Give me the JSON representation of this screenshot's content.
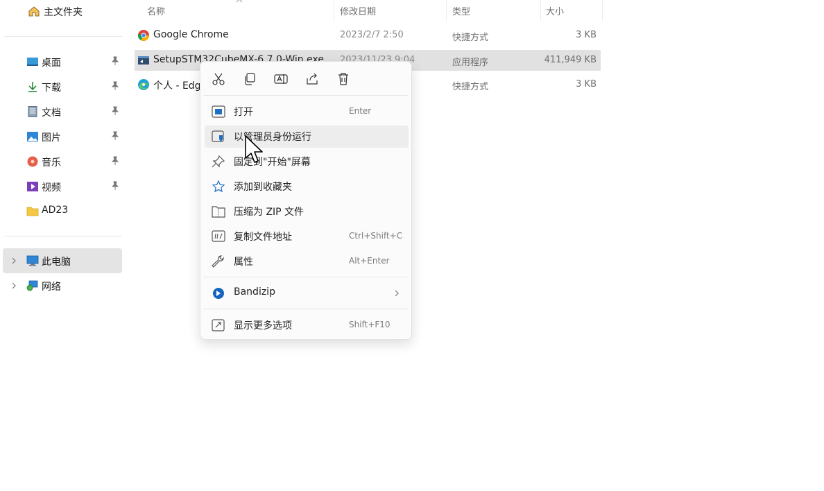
{
  "sidebar": {
    "home": "主文件夹",
    "quick_access": [
      {
        "label": "桌面",
        "icon": "desktop-icon"
      },
      {
        "label": "下载",
        "icon": "download-icon"
      },
      {
        "label": "文档",
        "icon": "document-icon"
      },
      {
        "label": "图片",
        "icon": "picture-icon"
      },
      {
        "label": "音乐",
        "icon": "music-icon"
      },
      {
        "label": "视频",
        "icon": "video-icon"
      },
      {
        "label": "AD23",
        "icon": "folder-icon"
      }
    ],
    "this_pc": "此电脑",
    "network": "网络"
  },
  "columns": {
    "name": "名称",
    "modified": "修改日期",
    "type": "类型",
    "size": "大小"
  },
  "files": [
    {
      "name": "Google Chrome",
      "modified": "2023/2/7 2:50",
      "type": "快捷方式",
      "size": "3 KB",
      "icon": "chrome-icon"
    },
    {
      "name": "SetupSTM32CubeMX-6.7.0-Win.exe",
      "modified": "2023/11/23 9:04",
      "type": "应用程序",
      "size": "411,949 KB",
      "icon": "stm32-installer-icon",
      "selected": true
    },
    {
      "name": "个人 - Edge",
      "modified": "",
      "type": "快捷方式",
      "size": "3 KB",
      "icon": "edge-icon"
    }
  ],
  "context_menu": {
    "quick_actions": [
      {
        "name": "cut-button",
        "icon": "scissors-icon"
      },
      {
        "name": "copy-button",
        "icon": "copy-icon"
      },
      {
        "name": "rename-button",
        "icon": "rename-icon"
      },
      {
        "name": "share-button",
        "icon": "share-icon"
      },
      {
        "name": "delete-button",
        "icon": "trash-icon"
      }
    ],
    "items": [
      {
        "label": "打开",
        "shortcut": "Enter",
        "icon": "open-icon"
      },
      {
        "label": "以管理员身份运行",
        "shortcut": "",
        "icon": "admin-shield-icon"
      },
      {
        "label": "固定到\"开始\"屏幕",
        "shortcut": "",
        "icon": "pin-icon"
      },
      {
        "label": "添加到收藏夹",
        "shortcut": "",
        "icon": "star-icon"
      },
      {
        "label": "压缩为 ZIP 文件",
        "shortcut": "",
        "icon": "zip-icon"
      },
      {
        "label": "复制文件地址",
        "shortcut": "Ctrl+Shift+C",
        "icon": "copy-path-icon"
      },
      {
        "label": "属性",
        "shortcut": "Alt+Enter",
        "icon": "wrench-icon"
      },
      {
        "label": "Bandizip",
        "shortcut": "",
        "icon": "bandizip-icon"
      },
      {
        "label": "显示更多选项",
        "shortcut": "Shift+F10",
        "icon": "more-options-icon"
      }
    ]
  },
  "colors": {
    "selection": "#e1e1e1",
    "hover": "#ededed",
    "accent": "#0067c0"
  }
}
